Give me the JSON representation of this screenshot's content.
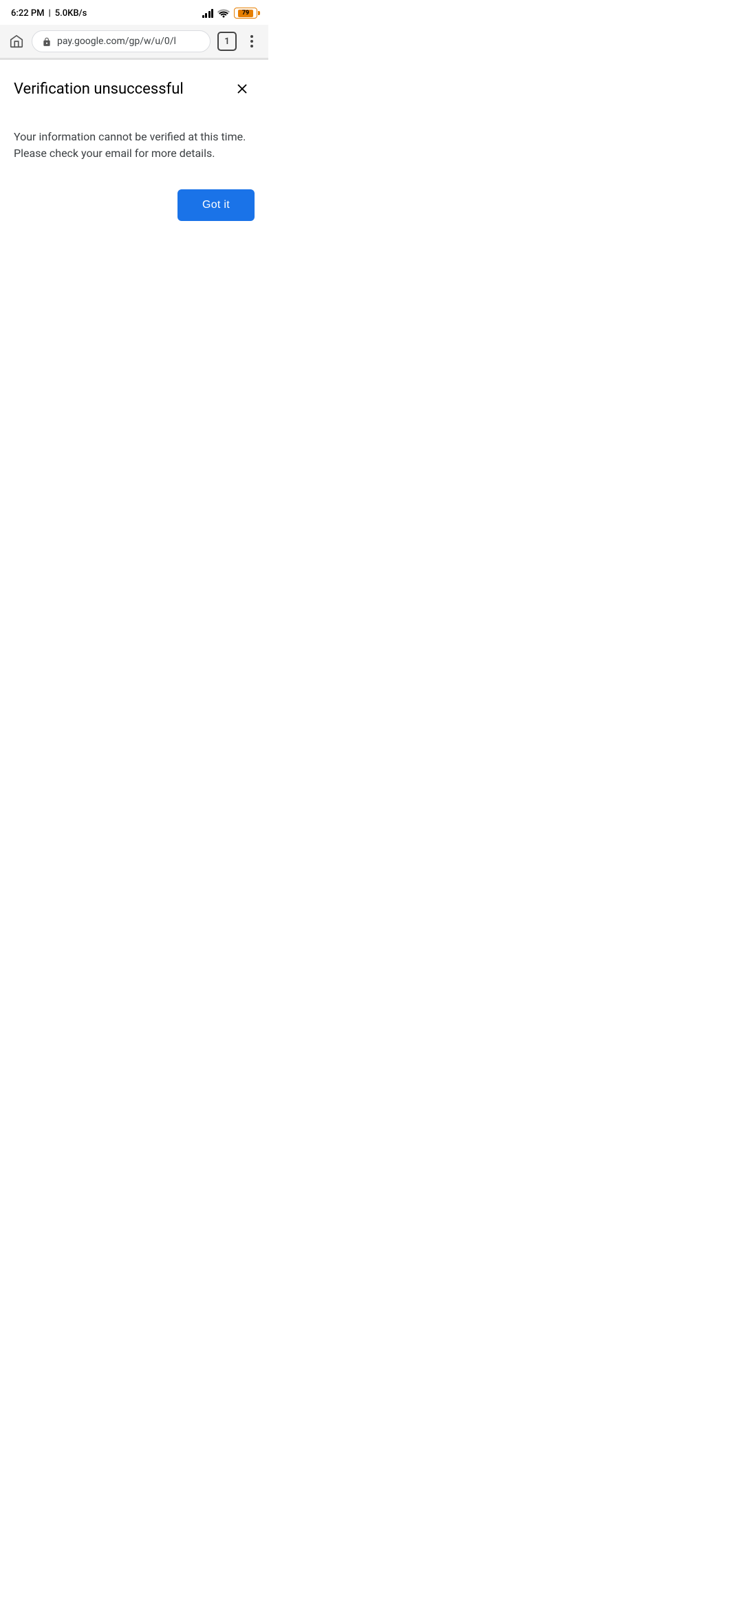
{
  "status_bar": {
    "time": "6:22 PM",
    "network_speed": "5.0KB/s",
    "battery_level": "79"
  },
  "browser": {
    "url": "pay.google.com/gp/w/u/0/l",
    "tab_count": "1"
  },
  "page": {
    "title": "Verification unsuccessful",
    "message": "Your information cannot be verified at this time. Please check your email for more details.",
    "got_it_label": "Got it"
  },
  "icons": {
    "home": "⌂",
    "lock": "🔒",
    "close": "✕"
  }
}
